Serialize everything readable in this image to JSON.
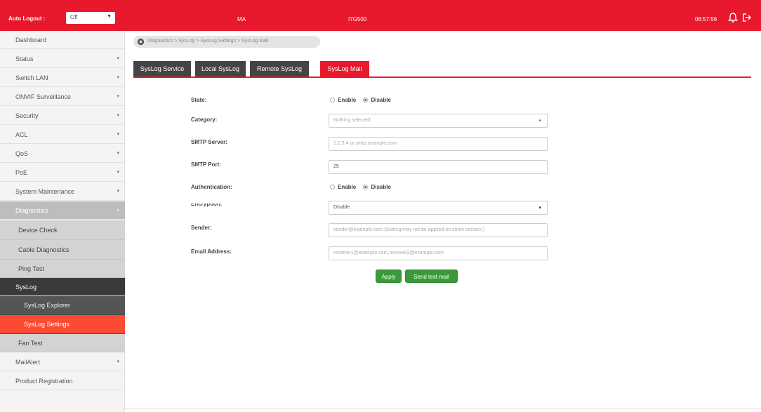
{
  "topbar": {
    "auto_logout_label": "Auto Logout :",
    "auto_logout_value": "Off",
    "center_left": "MA",
    "center_right": "I7G500",
    "time": "06:57:56",
    "bell_icon": "bell-icon",
    "logout_icon": "logout-icon"
  },
  "sidebar": {
    "items": [
      {
        "label": "Dashboard"
      },
      {
        "label": "Status"
      },
      {
        "label": "Switch LAN"
      },
      {
        "label": "ONVIF Surveillance"
      },
      {
        "label": "Security"
      },
      {
        "label": "ACL"
      },
      {
        "label": "QoS"
      },
      {
        "label": "PoE"
      },
      {
        "label": "System Maintenance"
      },
      {
        "label": "Diagnostics"
      },
      {
        "label": "Device Check"
      },
      {
        "label": "Cable Diagnostics"
      },
      {
        "label": "Ping Test"
      },
      {
        "label": "SysLog"
      },
      {
        "label": "SysLog Explorer"
      },
      {
        "label": "SysLog Settings"
      },
      {
        "label": "Fan Test"
      },
      {
        "label": "MailAlert"
      },
      {
        "label": "Product Registration"
      }
    ]
  },
  "breadcrumb": "Diagnostics > SysLog > SysLog Settings > SysLog Mail",
  "tabs": [
    "SysLog Service",
    "Local SysLog",
    "Remote SysLog",
    "SysLog Mail"
  ],
  "form": {
    "state_label": "State:",
    "state_enable": "Enable",
    "state_disable": "Disable",
    "category_label": "Category:",
    "category_placeholder": "Nothing selected",
    "smtp_server_label": "SMTP Server:",
    "smtp_server_placeholder": "1.2.3.4 or smtp.example.com",
    "smtp_port_label": "SMTP Port:",
    "smtp_port_value": "25",
    "auth_label": "Authentication:",
    "auth_enable": "Enable",
    "auth_disable": "Disable",
    "encryption_label": "Encryption:",
    "encryption_value": "Disable",
    "sender_label": "Sender:",
    "sender_placeholder": "sender@example.com (Setting may not be applied on some servers.)",
    "email_label": "Email Address:",
    "email_placeholder": "receiver1@example.com,receiver2@example.com",
    "apply_button": "Apply",
    "test_button": "Send test mail"
  },
  "colors": {
    "brand_red": "#e8192c",
    "selected_orange": "#ff4a33",
    "button_green": "#3a9a3a",
    "tab_dark": "#444444"
  }
}
